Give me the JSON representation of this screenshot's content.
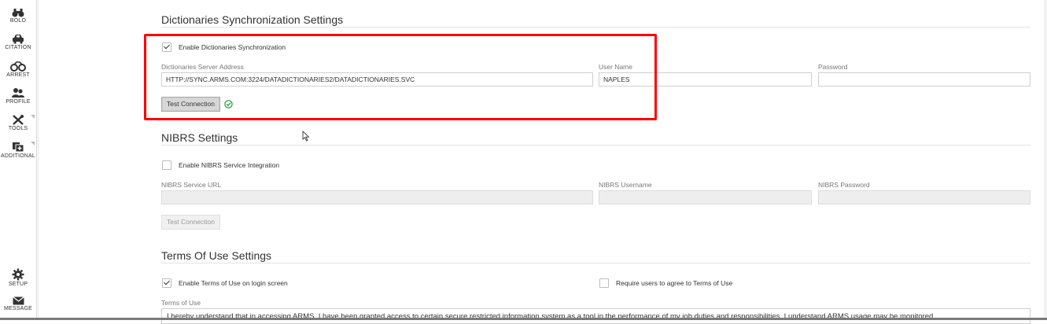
{
  "nav": {
    "items": [
      {
        "label": "BOLO",
        "icon": "binoculars-icon"
      },
      {
        "label": "CITATION",
        "icon": "car-icon"
      },
      {
        "label": "ARREST",
        "icon": "handcuffs-icon"
      },
      {
        "label": "PROFILE",
        "icon": "people-icon"
      },
      {
        "label": "TOOLS",
        "icon": "tools-icon"
      },
      {
        "label": "ADDITIONAL",
        "icon": "add-copy-icon"
      },
      {
        "label": "SETUP",
        "icon": "gear-icon"
      },
      {
        "label": "MESSAGE",
        "icon": "envelope-icon"
      }
    ]
  },
  "dict": {
    "title": "Dictionaries Synchronization Settings",
    "enable_label": "Enable Dictionaries Synchronization",
    "enabled": true,
    "server_label": "Dictionaries Server Address",
    "server_value": "HTTP://SYNC.ARMS.COM:3224/DATADICTIONARIES2/DATADICTIONARIES.SVC",
    "user_label": "User Name",
    "user_value": "NAPLES",
    "password_label": "Password",
    "password_value": "",
    "test_button": "Test Connection",
    "status_icon": "check-circle-icon",
    "status_color": "#2e9e44",
    "highlight_color": "#ff0000"
  },
  "nibrs": {
    "title": "NIBRS Settings",
    "enable_label": "Enable NIBRS Service Integration",
    "enabled": false,
    "url_label": "NIBRS Service URL",
    "url_value": "",
    "username_label": "NIBRS Username",
    "username_value": "",
    "password_label": "NIBRS Password",
    "password_value": "",
    "test_button": "Test Connection"
  },
  "terms": {
    "title": "Terms Of Use Settings",
    "enable_label": "Enable Terms of Use on login screen",
    "enabled": true,
    "require_label": "Require users to agree to Terms of Use",
    "require": false,
    "text_label": "Terms of Use",
    "text_value": "I hereby understand that in accessing ARMS, I have been granted access to certain secure restricted information system as a tool in the performance of my job duties and responsibilities. I understand ARMS usage may be monitored"
  }
}
